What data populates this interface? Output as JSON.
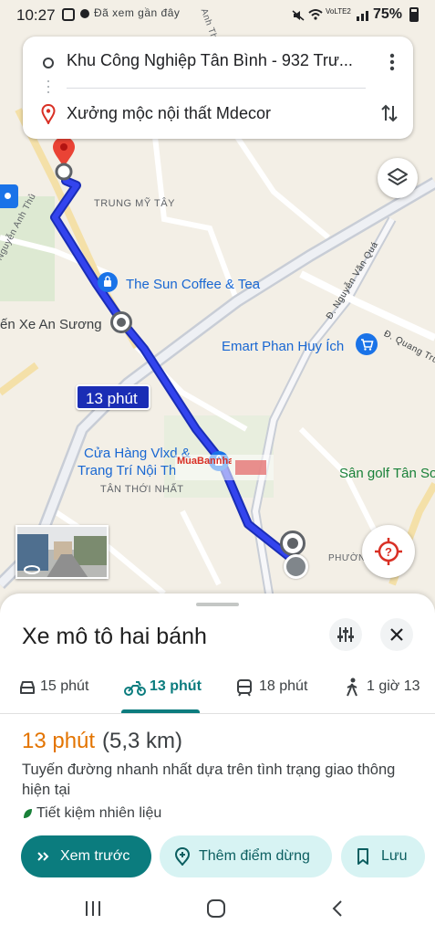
{
  "status_bar": {
    "time": "10:27",
    "battery": "75%",
    "network": "VoLTE2"
  },
  "directions_card": {
    "origin": "Khu Công Nghiệp Tân Bình - 932 Trư...",
    "destination": "Xưởng mộc nội thất Mdecor"
  },
  "map": {
    "area_labels": [
      "TRUNG MỸ TÂY",
      "TÂN THỚI NHẤT",
      "PHƯỜNG"
    ],
    "street_labels": [
      "Nguyễn Anh Thủ",
      "Đ. Nguyễn Văn Quá",
      "Đ. Quang Trung"
    ],
    "pois": {
      "coffee": "The Sun Coffee & Tea",
      "bus_station": "ến Xe An Sương",
      "emart": "Emart Phan Huy Ích",
      "hardware_store_line1": "Cửa Hàng Vlxd &",
      "hardware_store_line2": "Trang Trí Nội Th",
      "golf": "Sân golf Tân Sơ"
    },
    "route_badge": "13 phút",
    "watermark": "MuaBannha.vn",
    "top_labels": [
      "Đã xem gần đây",
      "Anh Thủ"
    ],
    "route_color": "#3344ee"
  },
  "sheet": {
    "title": "Xe mô tô hai bánh",
    "modes": [
      {
        "label": "15 phút",
        "icon": "car-icon"
      },
      {
        "label": "13 phút",
        "icon": "motorbike-icon",
        "selected": true
      },
      {
        "label": "18 phút",
        "icon": "transit-icon"
      },
      {
        "label": "1 giờ 13",
        "icon": "walk-icon"
      }
    ],
    "route_time": "13 phút",
    "route_distance": "(5,3 km)",
    "route_description": "Tuyến đường nhanh nhất dựa trên tình trạng giao thông hiện tại",
    "eco_note": "Tiết kiệm nhiên liệu",
    "buttons": {
      "preview": "Xem trước",
      "add_stop": "Thêm điểm dừng",
      "save": "Lưu"
    },
    "accent_color": "#0b7c7e",
    "time_color": "#e37400"
  }
}
